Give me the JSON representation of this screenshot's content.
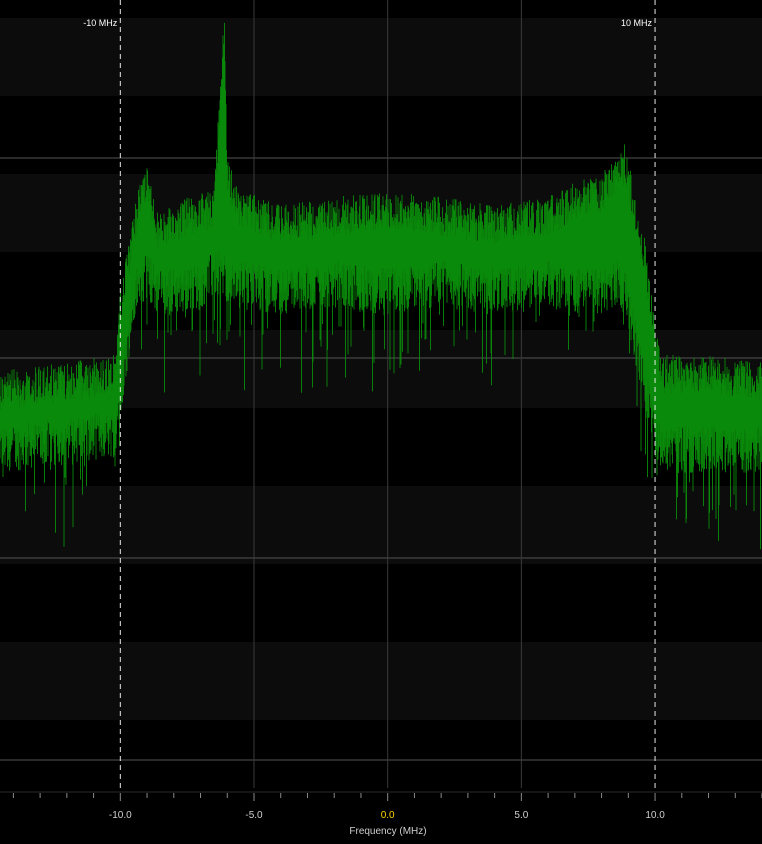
{
  "chart_data": {
    "type": "area",
    "xlabel": "Frequency (MHz)",
    "ylabel": "",
    "xlim": [
      -14.5,
      14.0
    ],
    "x_ticks": [
      -10.0,
      -5.0,
      0.0,
      5.0,
      10.0
    ],
    "x_tick_labels": [
      "-10.0",
      "-5.0",
      "0.0",
      "5.0",
      "10.0"
    ],
    "center_tick_color": "#ffd400",
    "grid": true,
    "trace_color": "#0a8a0a",
    "markers": [
      {
        "x": -10.0,
        "label": "-10 MHz"
      },
      {
        "x": 10.0,
        "label": "10 MHz"
      }
    ],
    "series": [
      {
        "x": [
          -14.5,
          -12.0,
          -10.2,
          -10.0,
          -9.4,
          -9.0,
          -8.6,
          -7.5,
          -6.5,
          -6.1,
          -6.0,
          -5.5,
          -4.0,
          -2.0,
          0.0,
          2.0,
          4.0,
          6.0,
          7.0,
          8.0,
          8.6,
          8.9,
          9.2,
          9.6,
          10.0,
          10.2,
          12.0,
          14.0
        ],
        "top_values": [
          0.53,
          0.54,
          0.55,
          0.63,
          0.75,
          0.8,
          0.73,
          0.75,
          0.76,
          0.99,
          0.8,
          0.76,
          0.74,
          0.75,
          0.76,
          0.75,
          0.74,
          0.75,
          0.77,
          0.78,
          0.8,
          0.82,
          0.76,
          0.7,
          0.59,
          0.55,
          0.55,
          0.54
        ],
        "floor_values": [
          0.4,
          0.41,
          0.42,
          0.47,
          0.6,
          0.62,
          0.6,
          0.6,
          0.62,
          0.62,
          0.6,
          0.61,
          0.6,
          0.61,
          0.6,
          0.61,
          0.6,
          0.61,
          0.6,
          0.6,
          0.61,
          0.6,
          0.55,
          0.48,
          0.42,
          0.4,
          0.4,
          0.4
        ]
      }
    ]
  }
}
